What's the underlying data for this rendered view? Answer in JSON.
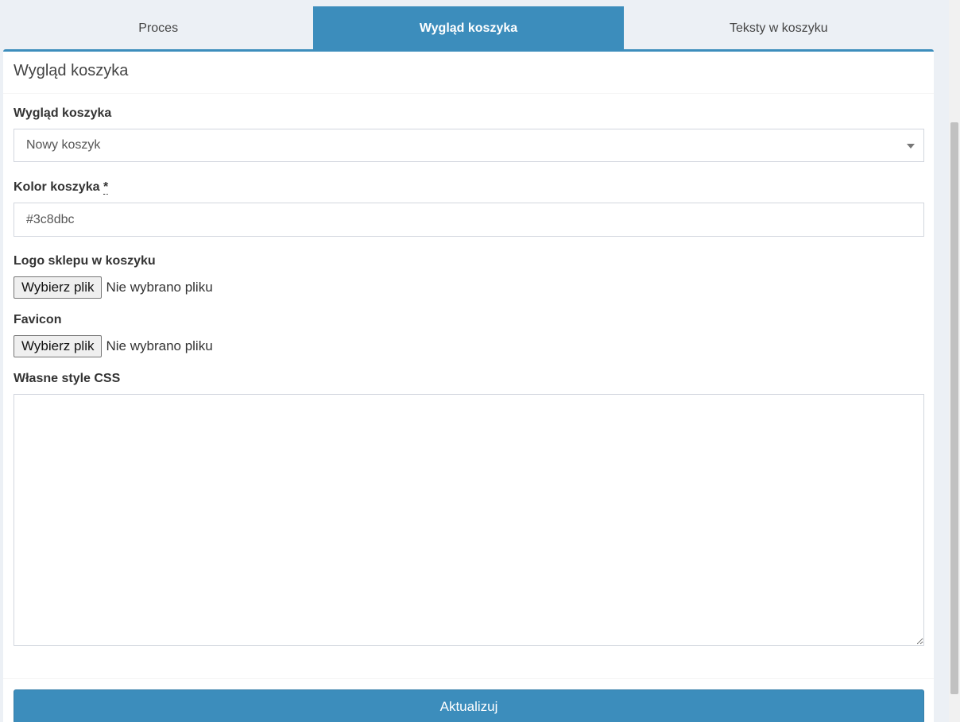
{
  "tabs": [
    {
      "label": "Proces",
      "active": false
    },
    {
      "label": "Wygląd koszyka",
      "active": true
    },
    {
      "label": "Teksty w koszyku",
      "active": false
    }
  ],
  "panel": {
    "title": "Wygląd koszyka"
  },
  "form": {
    "appearance": {
      "label": "Wygląd koszyka",
      "selected": "Nowy koszyk"
    },
    "color": {
      "label": "Kolor koszyka",
      "required_mark": "*",
      "value": "#3c8dbc"
    },
    "logo": {
      "label": "Logo sklepu w koszyku",
      "button": "Wybierz plik",
      "status": "Nie wybrano pliku"
    },
    "favicon": {
      "label": "Favicon",
      "button": "Wybierz plik",
      "status": "Nie wybrano pliku"
    },
    "css": {
      "label": "Własne style CSS",
      "value": ""
    }
  },
  "footer": {
    "submit_label": "Aktualizuj"
  },
  "colors": {
    "accent": "#3c8dbc",
    "background": "#ecf0f5"
  }
}
